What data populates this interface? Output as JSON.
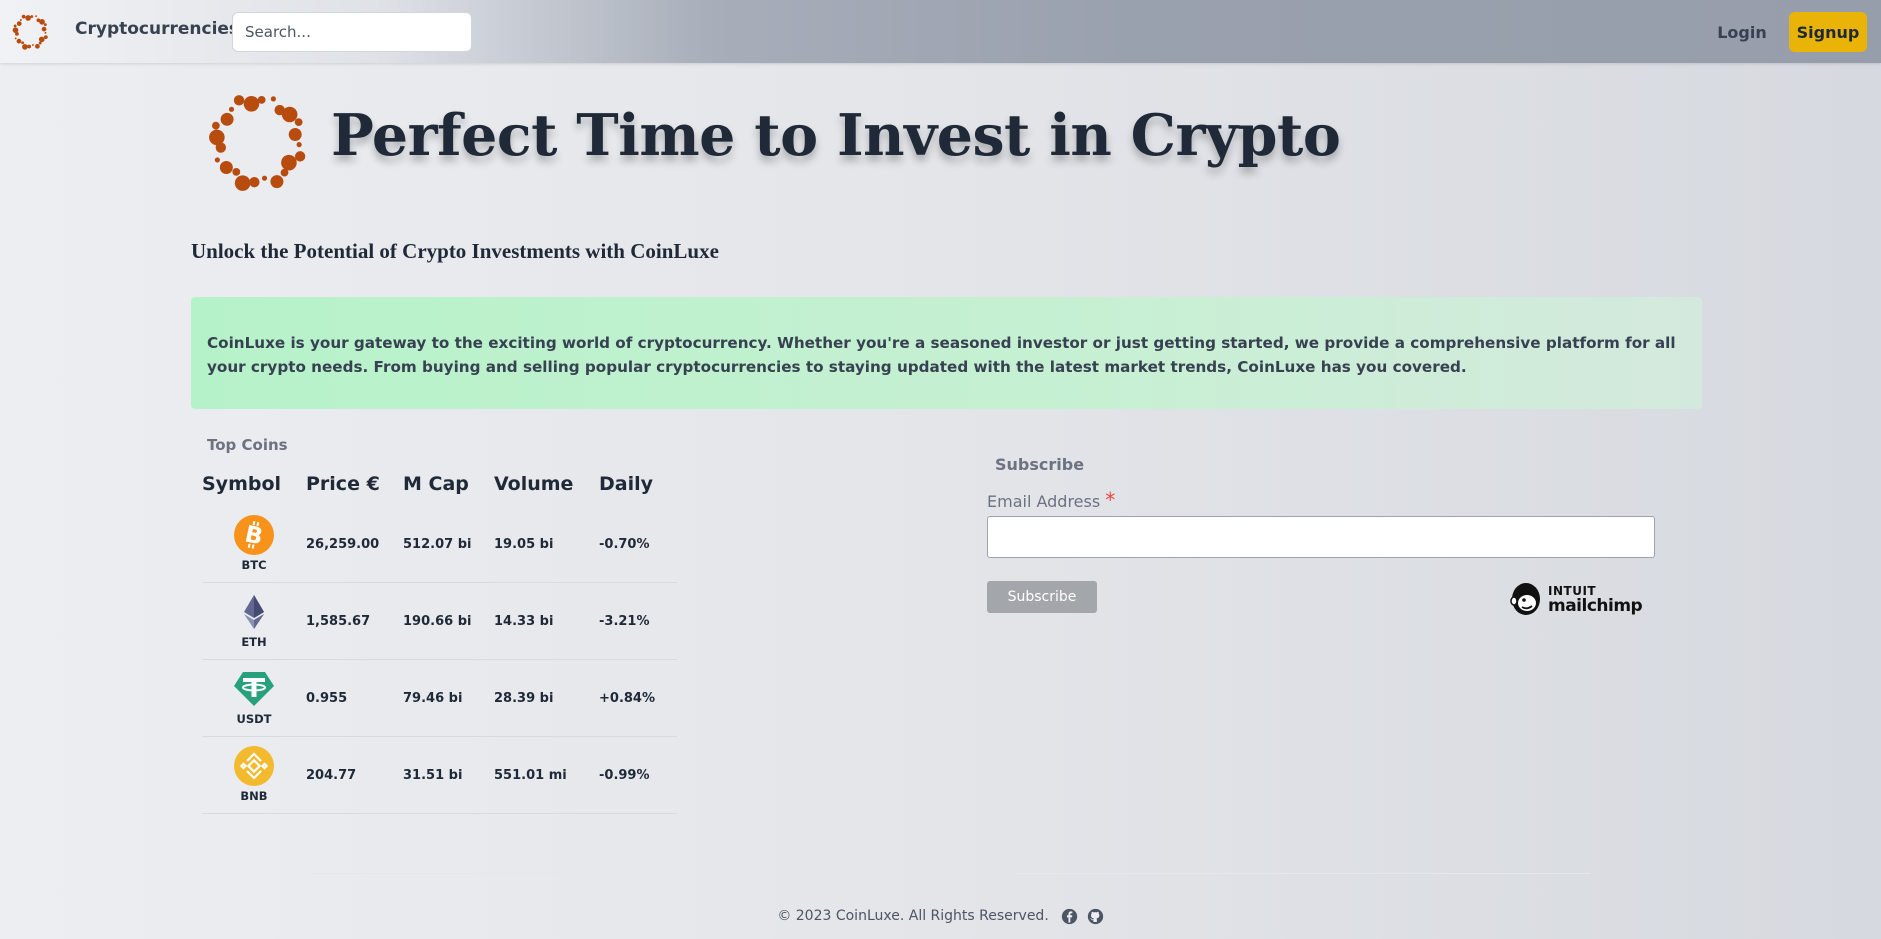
{
  "navbar": {
    "brand": "Cryptocurrencies",
    "search_placeholder": "Search...",
    "login": "Login",
    "signup": "Signup"
  },
  "hero": {
    "title": "Perfect Time to Invest in Crypto",
    "subtitle": "Unlock the Potential of Crypto Investments with CoinLuxe",
    "intro": "CoinLuxe is your gateway to the exciting world of cryptocurrency. Whether you're a seasoned investor or just getting started, we provide a comprehensive platform for all your crypto needs. From buying and selling popular cryptocurrencies to staying updated with the latest market trends, CoinLuxe has you covered."
  },
  "coins": {
    "caption": "Top Coins",
    "headers": [
      "Symbol",
      "Price €",
      "M Cap",
      "Volume",
      "Daily"
    ],
    "rows": [
      {
        "symbol": "BTC",
        "icon": "bitcoin-icon",
        "price": "26,259.00",
        "mcap": "512.07 bi",
        "volume": "19.05 bi",
        "daily": "-0.70%"
      },
      {
        "symbol": "ETH",
        "icon": "ethereum-icon",
        "price": "1,585.67",
        "mcap": "190.66 bi",
        "volume": "14.33 bi",
        "daily": "-3.21%"
      },
      {
        "symbol": "USDT",
        "icon": "tether-icon",
        "price": "0.955",
        "mcap": "79.46 bi",
        "volume": "28.39 bi",
        "daily": "+0.84%"
      },
      {
        "symbol": "BNB",
        "icon": "bnb-icon",
        "price": "204.77",
        "mcap": "31.51 bi",
        "volume": "551.01 mi",
        "daily": "-0.99%"
      }
    ]
  },
  "subscribe": {
    "title": "Subscribe",
    "email_label": "Email Address",
    "required_mark": "*",
    "email_value": "",
    "button": "Subscribe",
    "badge_top": "INTUIT",
    "badge_name": "mailchimp"
  },
  "footer": {
    "copyright": "© 2023 CoinLuxe. All Rights Reserved."
  },
  "colors": {
    "accent": "#eab308",
    "logo": "#b84c0f",
    "negative": "#ef4444",
    "positive": "#16a34a",
    "intro_bg": "#bbf7d0"
  }
}
